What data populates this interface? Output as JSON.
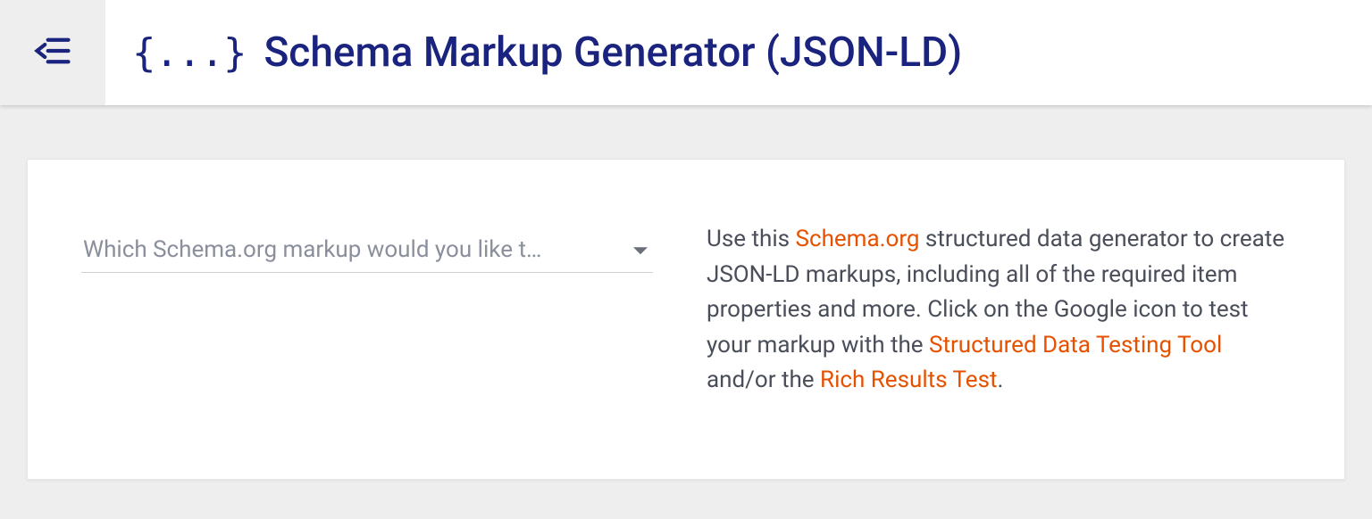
{
  "header": {
    "icon_label": "{...}",
    "title": "Schema Markup Generator (JSON-LD)"
  },
  "select": {
    "placeholder": "Which Schema.org markup would you like t…"
  },
  "description": {
    "t1": "Use this ",
    "link1": "Schema.org",
    "t2": " structured data generator to create JSON-LD markups, including all of the required item properties and more. Click on the Google icon to test your markup with the ",
    "link2": "Structured Data Testing Tool",
    "t3": " and/or the ",
    "link3": "Rich Results Test",
    "t4": "."
  }
}
